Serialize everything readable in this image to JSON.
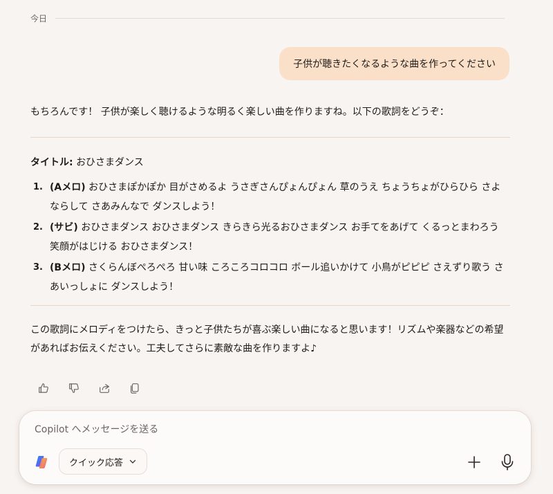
{
  "conversation": {
    "date_label": "今日",
    "user_message": "子供が聴きたくなるような曲を作ってください",
    "assistant": {
      "intro": "もちろんです！ 子供が楽しく聴けるような明るく楽しい曲を作りますね。以下の歌詞をどうぞ：",
      "title_label": "タイトル:",
      "title_value": "おひさまダンス",
      "verses": [
        {
          "num": "1.",
          "tag": "(Aメロ)",
          "text": "おひさまぽかぽか 目がさめるよ うさぎさんぴょんぴょん 草のうえ ちょうちょがひらひら さよならして さあみんなで ダンスしよう！"
        },
        {
          "num": "2.",
          "tag": "(サビ)",
          "text": "おひさまダンス おひさまダンス きらきら光るおひさまダンス お手てをあげて くるっとまわろう 笑顔がはじける おひさまダンス！"
        },
        {
          "num": "3.",
          "tag": "(Bメロ)",
          "text": "さくらんぼぺろぺろ 甘い味 ころころコロコロ ボール追いかけて 小鳥がピピピ さえずり歌う さあいっしょに ダンスしよう！"
        }
      ],
      "outro": "この歌詞にメロディをつけたら、きっと子供たちが喜ぶ楽しい曲になると思います！リズムや楽器などの希望があればお伝えください。工夫してさらに素敵な曲を作りますよ♪"
    },
    "actions": [
      {
        "name": "like-icon"
      },
      {
        "name": "dislike-icon"
      },
      {
        "name": "share-icon"
      },
      {
        "name": "copy-icon"
      }
    ]
  },
  "composer": {
    "placeholder": "Copilot へメッセージを送る",
    "value": "",
    "mode_label": "クイック応答",
    "icons": [
      "copilot-logo-icon",
      "chevron-down-icon",
      "plus-icon",
      "microphone-icon"
    ]
  }
}
